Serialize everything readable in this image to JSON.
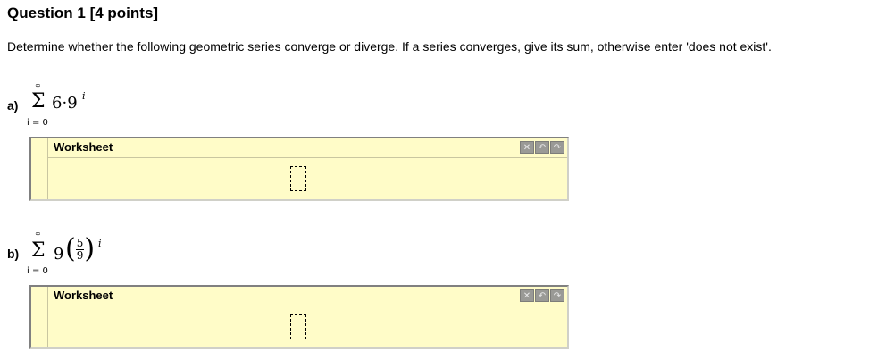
{
  "question": {
    "title": "Question 1 [4 points]",
    "instructions": "Determine whether the following geometric series converge or diverge. If a series converges, give its sum, otherwise enter 'does not exist'."
  },
  "parts": [
    {
      "label": "a)",
      "sum_upper": "∞",
      "sum_lower": "i = 0",
      "coefficient": "6",
      "dot": "·",
      "base": "9",
      "exponent": "i",
      "worksheet": {
        "title": "Worksheet",
        "answer_value": ""
      }
    },
    {
      "label": "b)",
      "sum_upper": "∞",
      "sum_lower": "i = 0",
      "coefficient": "9",
      "numerator": "5",
      "denominator": "9",
      "exponent": "i",
      "worksheet": {
        "title": "Worksheet",
        "answer_value": ""
      }
    }
  ],
  "toolbar_icons": [
    "close-icon",
    "undo-icon",
    "redo-icon"
  ],
  "colors": {
    "worksheet_bg": "#fffcc8",
    "worksheet_border": "#808080",
    "tool_bg": "#9a9a96"
  }
}
